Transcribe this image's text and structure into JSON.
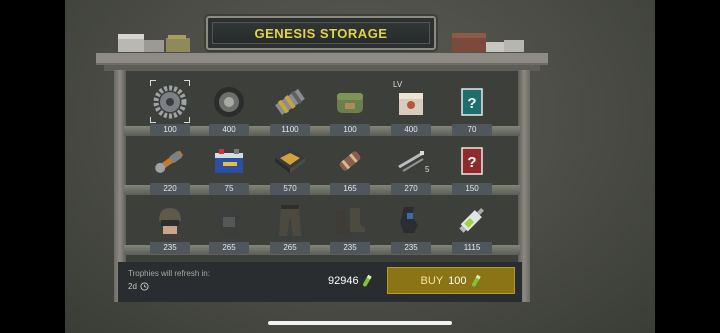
{
  "header": {
    "title": "GENESIS STORAGE"
  },
  "colors": {
    "title": "#e2d34a",
    "buy_button": "#8a7416",
    "price_tag": "#4f565c",
    "currency": "#7ec43a"
  },
  "shelves": [
    {
      "items": [
        {
          "icon": "gear-icon",
          "price": "100",
          "selected": true
        },
        {
          "icon": "wheel-icon",
          "price": "400"
        },
        {
          "icon": "engine-part-icon",
          "price": "1100"
        },
        {
          "icon": "bag-icon",
          "price": "100"
        },
        {
          "icon": "crate-icon",
          "price": "400",
          "badge": "LV"
        },
        {
          "icon": "mystery-card-icon",
          "price": "70"
        }
      ]
    },
    {
      "items": [
        {
          "icon": "wrench-icon",
          "price": "220"
        },
        {
          "icon": "battery-icon",
          "price": "75"
        },
        {
          "icon": "circuit-board-icon",
          "price": "570"
        },
        {
          "icon": "tube-icon",
          "price": "165"
        },
        {
          "icon": "rods-icon",
          "price": "270",
          "quantity": "5"
        },
        {
          "icon": "mystery-card-red-icon",
          "price": "150"
        }
      ]
    },
    {
      "items": [
        {
          "icon": "helmet-icon",
          "price": "235"
        },
        {
          "icon": "armor-vest-icon",
          "price": "265"
        },
        {
          "icon": "pants-icon",
          "price": "265"
        },
        {
          "icon": "boots-icon",
          "price": "235"
        },
        {
          "icon": "gloves-icon",
          "price": "235"
        },
        {
          "icon": "syringe-icon",
          "price": "1115"
        }
      ]
    }
  ],
  "footer": {
    "refresh_label": "Trophies will refresh in:",
    "refresh_time": "2d",
    "balance": "92946",
    "buy_label": "BUY",
    "buy_amount": "100"
  }
}
